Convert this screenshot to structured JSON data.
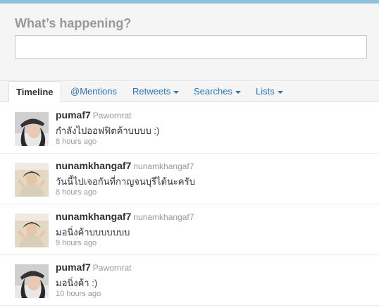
{
  "composer": {
    "title": "What’s happening?",
    "value": ""
  },
  "tabs": [
    {
      "label": "Timeline",
      "active": true
    },
    {
      "label": "@Mentions"
    },
    {
      "label": "Retweets",
      "dropdown": true
    },
    {
      "label": "Searches",
      "dropdown": true
    },
    {
      "label": "Lists",
      "dropdown": true
    }
  ],
  "tweets": [
    {
      "screen_name": "pumaf7",
      "real_name": "Pawornrat",
      "text": "กำลังไปออฟฟิตค้าบบบบ :)",
      "time": "8 hours ago",
      "avatar": "avatar-pumaf7"
    },
    {
      "screen_name": "nunamkhangaf7",
      "real_name": "nunamkhangaf7",
      "text": "วันนี้ไปเจอกันที่กาญจนบุรีได้นะครับ",
      "time": "8 hours ago",
      "avatar": "avatar-nunamkhangaf7"
    },
    {
      "screen_name": "nunamkhangaf7",
      "real_name": "nunamkhangaf7",
      "text": "มอนิ่งค้าบบบบบบบ",
      "time": "9 hours ago",
      "avatar": "avatar-nunamkhangaf7"
    },
    {
      "screen_name": "pumaf7",
      "real_name": "Pawornrat",
      "text": "มอนิ่งค้า :)",
      "time": "10 hours ago",
      "avatar": "avatar-pumaf7"
    }
  ],
  "colors": {
    "link": "#2276bb",
    "top_bar": "#8ec1da",
    "muted": "#999999"
  }
}
